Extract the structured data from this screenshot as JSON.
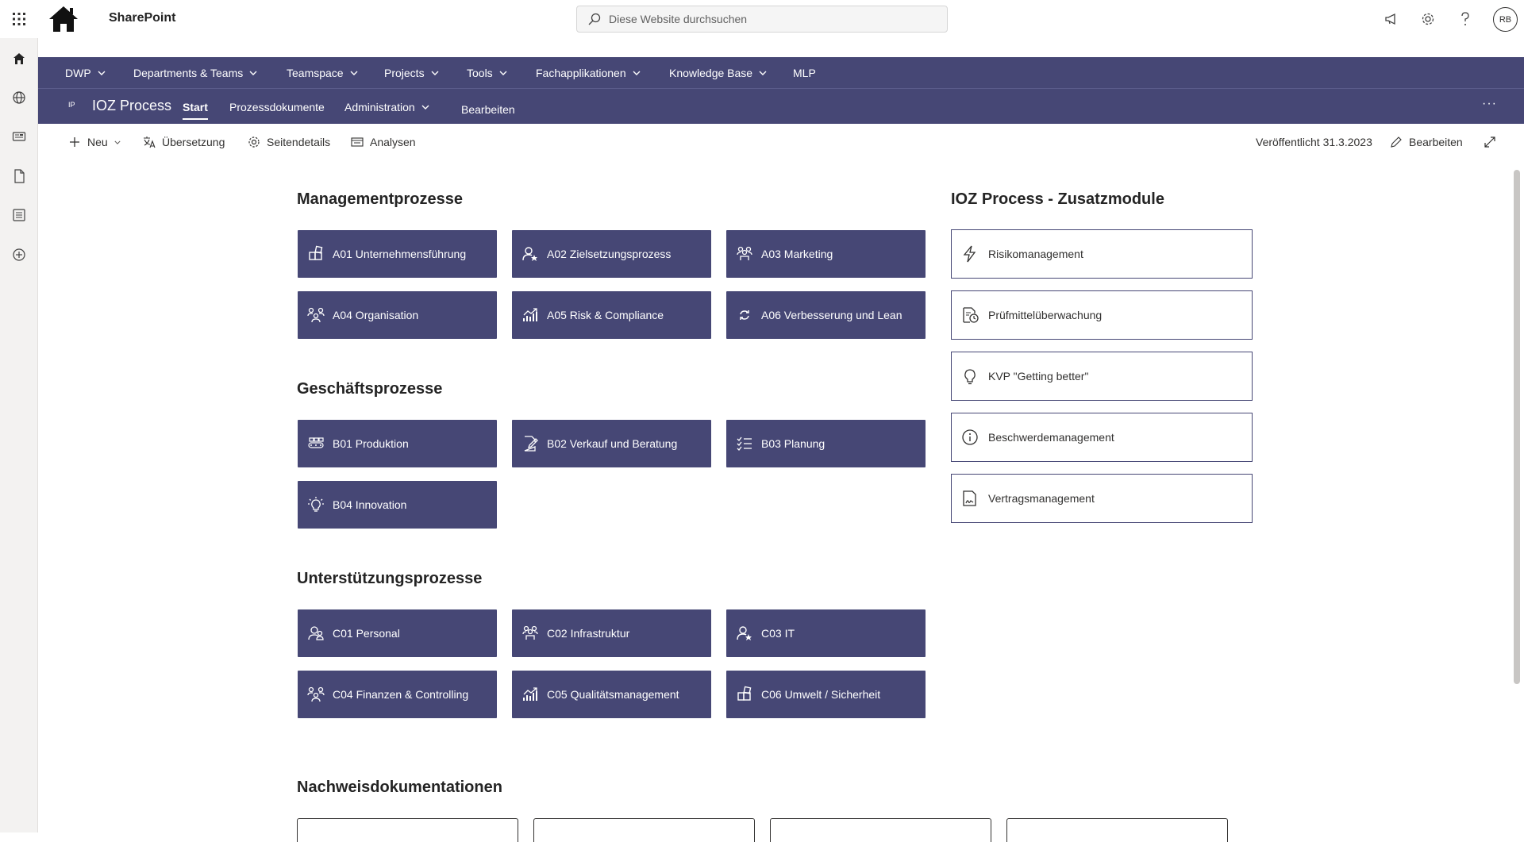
{
  "suite": {
    "app_name": "SharePoint",
    "search_placeholder": "Diese Website durchsuchen",
    "avatar_initials": "RB"
  },
  "hub_nav": [
    {
      "label": "DWP",
      "has_dropdown": true
    },
    {
      "label": "Departments & Teams",
      "has_dropdown": true
    },
    {
      "label": "Teamspace",
      "has_dropdown": true
    },
    {
      "label": "Projects",
      "has_dropdown": true
    },
    {
      "label": "Tools",
      "has_dropdown": true
    },
    {
      "label": "Fachapplikationen",
      "has_dropdown": true
    },
    {
      "label": "Knowledge Base",
      "has_dropdown": true
    },
    {
      "label": "MLP",
      "has_dropdown": false
    }
  ],
  "site": {
    "logo_text": "IP",
    "title": "IOZ Process",
    "nav": [
      {
        "label": "Start",
        "active": true
      },
      {
        "label": "Prozessdokumente"
      },
      {
        "label": "Administration",
        "has_dropdown": true
      },
      {
        "label": "Bearbeiten"
      }
    ],
    "more": "···"
  },
  "commandbar": {
    "new_label": "Neu",
    "translation_label": "Übersetzung",
    "page_details_label": "Seitendetails",
    "analytics_label": "Analysen",
    "published_label": "Veröffentlicht 31.3.2023",
    "edit_label": "Bearbeiten"
  },
  "sections": {
    "management": {
      "title": "Managementprozesse",
      "tiles": [
        {
          "label": "A01 Unternehmensführung",
          "icon": "building-blocks-icon"
        },
        {
          "label": "A02 Zielsetzungsprozess",
          "icon": "person-star-icon"
        },
        {
          "label": "A03 Marketing",
          "icon": "people-team-icon"
        },
        {
          "label": "A04 Organisation",
          "icon": "org-people-icon"
        },
        {
          "label": "A05 Risk & Compliance",
          "icon": "chart-growth-icon"
        },
        {
          "label": "A06 Verbesserung und Lean",
          "icon": "arrows-sync-icon"
        }
      ]
    },
    "business": {
      "title": "Geschäftsprozesse",
      "tiles": [
        {
          "label": "B01 Produktion",
          "icon": "conveyor-icon"
        },
        {
          "label": "B02 Verkauf und Beratung",
          "icon": "document-edit-icon"
        },
        {
          "label": "B03 Planung",
          "icon": "checklist-icon"
        },
        {
          "label": "B04 Innovation",
          "icon": "lightbulb-icon"
        }
      ]
    },
    "support": {
      "title": "Unterstützungsprozesse",
      "tiles": [
        {
          "label": "C01 Personal",
          "icon": "people-icon"
        },
        {
          "label": "C02 Infrastruktur",
          "icon": "people-team-icon"
        },
        {
          "label": "C03 IT",
          "icon": "person-star-icon"
        },
        {
          "label": "C04 Finanzen & Controlling",
          "icon": "org-people-icon"
        },
        {
          "label": "C05 Qualitätsmanagement",
          "icon": "chart-growth-icon"
        },
        {
          "label": "C06 Umwelt / Sicherheit",
          "icon": "building-blocks-icon"
        }
      ]
    },
    "modules": {
      "title": "IOZ Process - Zusatzmodule",
      "items": [
        {
          "label": "Risikomanagement",
          "icon": "flash-icon"
        },
        {
          "label": "Prüfmittelüberwachung",
          "icon": "document-clock-icon"
        },
        {
          "label": "KVP \"Getting better\"",
          "icon": "lightbulb-icon"
        },
        {
          "label": "Beschwerdemanagement",
          "icon": "info-icon"
        },
        {
          "label": "Vertragsmanagement",
          "icon": "document-signature-icon"
        }
      ]
    },
    "evidence": {
      "title": "Nachweisdokumentationen"
    }
  },
  "colors": {
    "brand": "#464775",
    "background": "#ffffff",
    "text": "#323130"
  }
}
